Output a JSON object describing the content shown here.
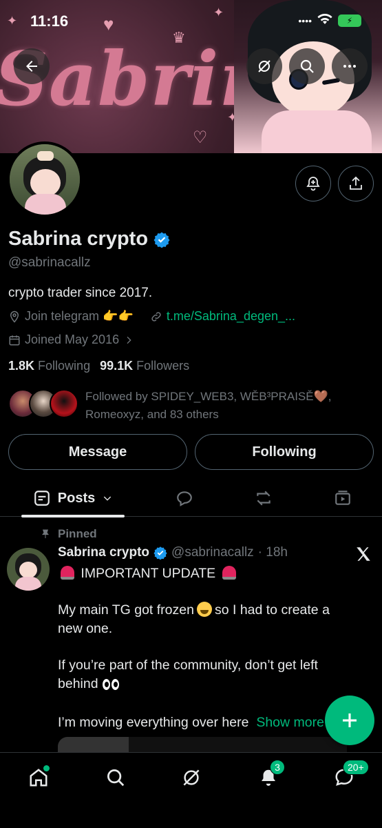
{
  "status_bar": {
    "time": "11:16",
    "battery": "⚡"
  },
  "banner": {
    "title": "Sabrina"
  },
  "profile": {
    "name": "Sabrina crypto",
    "handle": "@sabrinacallz",
    "bio": "crypto trader since 2017.",
    "location": "Join telegram 👉👉",
    "link": "t.me/Sabrina_degen_...",
    "joined": "Joined May 2016",
    "following_count": "1.8K",
    "following_label": "Following",
    "followers_count": "99.1K",
    "followers_label": "Followers",
    "followed_by": "Followed by SPIDEY_WEB3, WĚB³PRAISĚ🤎, Romeoxyz, and 83 others"
  },
  "buttons": {
    "message": "Message",
    "following": "Following"
  },
  "tabs": {
    "posts": "Posts"
  },
  "post": {
    "pinned_label": "Pinned",
    "author_name": "Sabrina crypto",
    "author_handle": "@sabrinacallz",
    "time": "· 18h",
    "line1": "IMPORTANT UPDATE",
    "para2a": "My main TG got frozen",
    "para2b": "so I had to create a new one.",
    "para3": "If you’re part of the community, don’t get left behind",
    "para4": "I’m moving everything over here",
    "show_more": "Show more"
  },
  "nav": {
    "notifications_badge": "3",
    "messages_badge": "20+"
  },
  "colors": {
    "accent": "#00ba7c",
    "verified": "#1d9bf0",
    "muted": "#71767b"
  }
}
